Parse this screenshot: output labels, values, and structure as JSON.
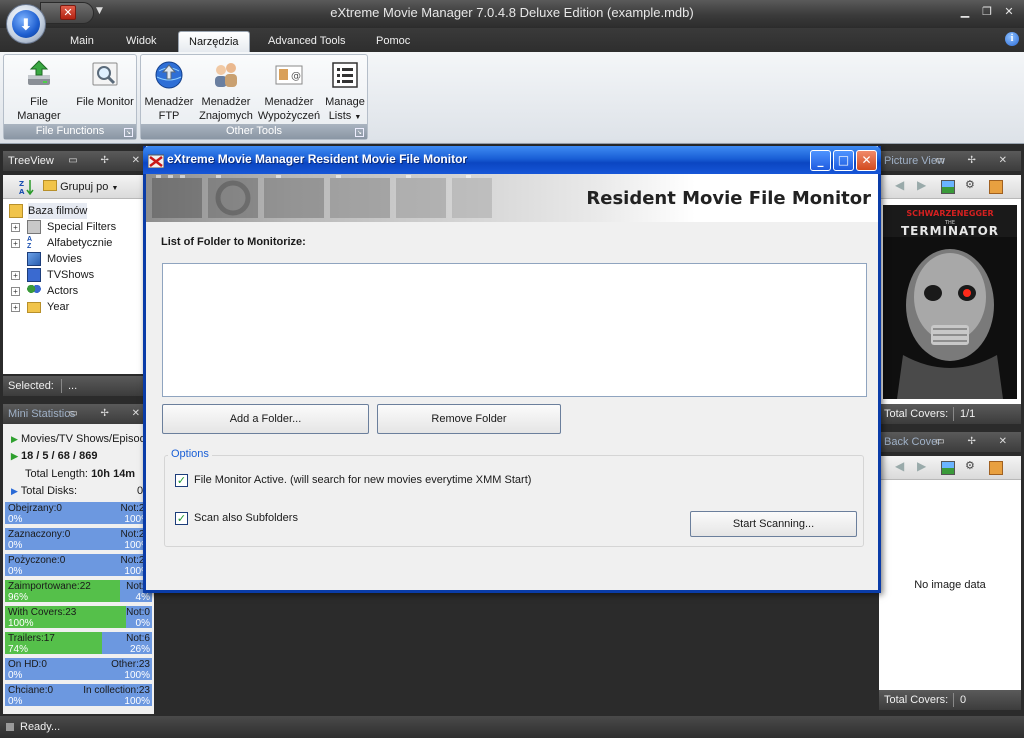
{
  "window": {
    "title": "eXtreme Movie Manager 7.0.4.8 Deluxe Edition (example.mdb)"
  },
  "ribbon": {
    "tabs": [
      {
        "label": "Main"
      },
      {
        "label": "Widok"
      },
      {
        "label": "Narzędzia",
        "active": true
      },
      {
        "label": "Advanced Tools"
      },
      {
        "label": "Pomoc"
      }
    ],
    "groups": {
      "file_functions": {
        "label": "File Functions",
        "buttons": [
          {
            "label": "File Manager",
            "icon": "file-manager-icon"
          },
          {
            "label": "File Monitor",
            "icon": "file-monitor-icon"
          }
        ]
      },
      "other_tools": {
        "label": "Other Tools",
        "buttons": [
          {
            "label1": "Menadżer",
            "label2": "FTP",
            "icon": "ftp-globe-icon"
          },
          {
            "label1": "Menadżer",
            "label2": "Znajomych",
            "icon": "friends-icon"
          },
          {
            "label1": "Menadżer",
            "label2": "Wypożyczeń",
            "icon": "loans-icon"
          },
          {
            "label1": "Manage",
            "label2": "Lists",
            "icon": "lists-icon"
          }
        ]
      }
    }
  },
  "treeview": {
    "title": "TreeView",
    "group_button": "Grupuj po",
    "root": "Baza filmów",
    "items": [
      {
        "label": "Special Filters",
        "icon": "filter-icon",
        "expandable": true
      },
      {
        "label": "Alfabetycznie",
        "icon": "sort-az-icon",
        "expandable": true
      },
      {
        "label": "Movies",
        "icon": "movies-icon",
        "expandable": false
      },
      {
        "label": "TVShows",
        "icon": "tv-icon",
        "expandable": true
      },
      {
        "label": "Actors",
        "icon": "actors-icon",
        "expandable": true
      },
      {
        "label": "Year",
        "icon": "folder-icon",
        "expandable": true
      }
    ],
    "selected_label": "Selected:",
    "selected_value": "..."
  },
  "mini_stats": {
    "title": "Mini Statistics",
    "heading": "Movies/TV Shows/Episodes",
    "counts": "18 / 5 / 68 / 869",
    "total_length_label": "Total Length:",
    "total_length_value": "10h 14m",
    "total_disks_label": "Total Disks:",
    "total_disks_value": "0",
    "bars": [
      {
        "left": "Obejrzany:0",
        "right": "Not:23",
        "left_pct": "0%",
        "right_pct": "100%",
        "fill": 0.0
      },
      {
        "left": "Zaznaczony:0",
        "right": "Not:23",
        "left_pct": "0%",
        "right_pct": "100%",
        "fill": 0.0
      },
      {
        "left": "Pożyczone:0",
        "right": "Not:23",
        "left_pct": "0%",
        "right_pct": "100%",
        "fill": 0.0
      },
      {
        "left": "Zaimportowane:22",
        "right": "Not:1",
        "left_pct": "96%",
        "right_pct": "4%",
        "fill": 0.78
      },
      {
        "left": "With Covers:23",
        "right": "Not:0",
        "left_pct": "100%",
        "right_pct": "0%",
        "fill": 0.82
      },
      {
        "left": "Trailers:17",
        "right": "Not:6",
        "left_pct": "74%",
        "right_pct": "26%",
        "fill": 0.66
      },
      {
        "left": "On HD:0",
        "right": "Other:23",
        "left_pct": "0%",
        "right_pct": "100%",
        "fill": 0.0
      },
      {
        "left": "Chciane:0",
        "right": "In collection:23",
        "left_pct": "0%",
        "right_pct": "100%",
        "fill": 0.0
      }
    ]
  },
  "picture_view": {
    "title": "Picture View",
    "poster_actor": "SCHWARZENEGGER",
    "poster_the": "THE",
    "poster_title": "TERMINATOR",
    "total_covers_label": "Total Covers:",
    "total_covers_value": "1/1"
  },
  "back_cover": {
    "title": "Back Cover",
    "empty_text": "No image data",
    "total_covers_label": "Total Covers:",
    "total_covers_value": "0"
  },
  "status": {
    "text": "Ready..."
  },
  "dialog": {
    "title": "eXtreme Movie Manager Resident Movie File Monitor",
    "banner_title": "Resident Movie File Monitor",
    "list_label": "List of Folder to Monitorize:",
    "add_button": "Add a Folder...",
    "remove_button": "Remove Folder",
    "options_label": "Options",
    "checkbox_active": "File Monitor Active. (will search for new movies everytime XMM Start)",
    "checkbox_subfolders": "Scan also Subfolders",
    "start_button": "Start Scanning..."
  }
}
